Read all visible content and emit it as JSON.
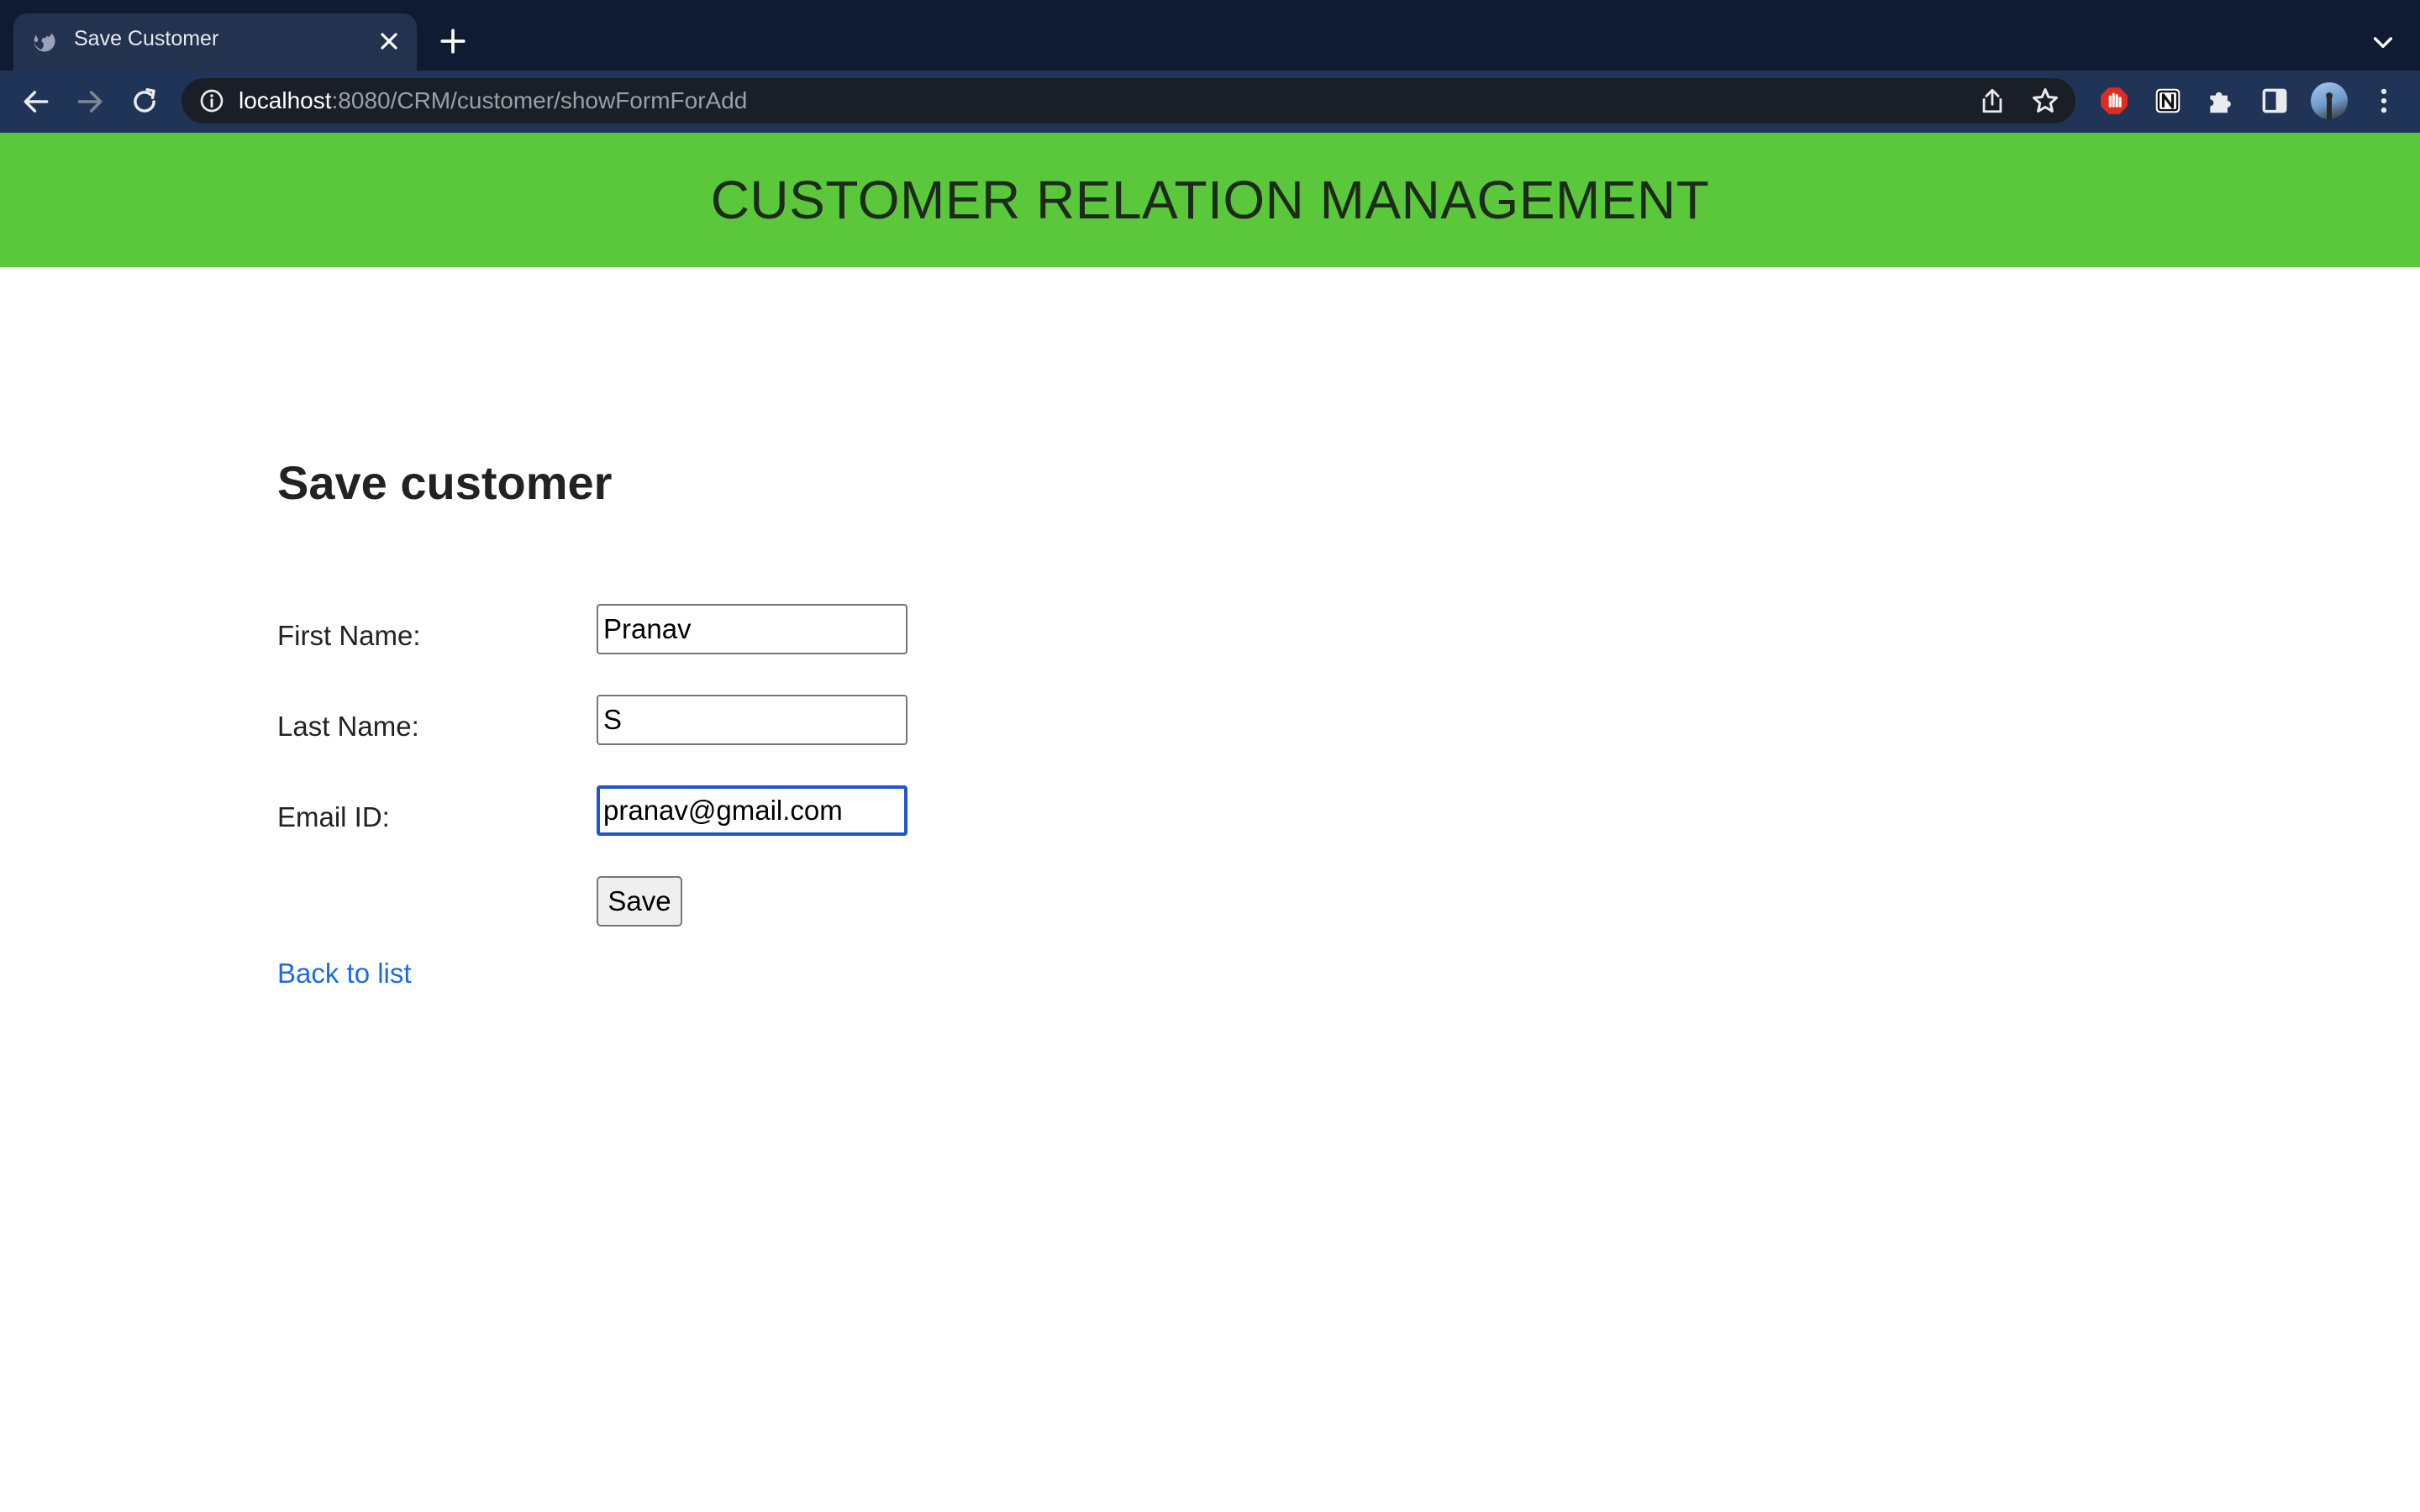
{
  "browser": {
    "tab": {
      "title": "Save Customer",
      "favicon": "globe-icon",
      "close_icon": "close-icon"
    },
    "new_tab_icon": "plus-icon",
    "tab_search_icon": "chevron-down-icon",
    "nav": {
      "back_icon": "arrow-left-icon",
      "forward_icon": "arrow-right-icon",
      "reload_icon": "reload-icon"
    },
    "omnibox": {
      "host": "localhost",
      "rest": ":8080/CRM/customer/showFormForAdd",
      "info_icon": "info-icon",
      "share_icon": "share-icon",
      "bookmark_icon": "star-icon"
    },
    "extensions": [
      "ad-block-icon",
      "notion-icon",
      "puzzle-icon",
      "side-panel-icon"
    ],
    "profile_icon": "avatar",
    "menu_icon": "kebab-menu-icon"
  },
  "colors": {
    "banner": "#5ac83a",
    "link": "#1a6de0",
    "focus": "#1d57c7",
    "chrome_dark": "#0f1a33"
  },
  "page": {
    "banner_title": "CUSTOMER RELATION MANAGEMENT",
    "heading": "Save customer",
    "form": {
      "first_name_label": "First Name:",
      "first_name_value": "Pranav",
      "last_name_label": "Last Name:",
      "last_name_value": "S",
      "email_label": "Email ID:",
      "email_value": "pranav@gmail.com",
      "save_label": "Save"
    },
    "back_link": "Back to list"
  }
}
